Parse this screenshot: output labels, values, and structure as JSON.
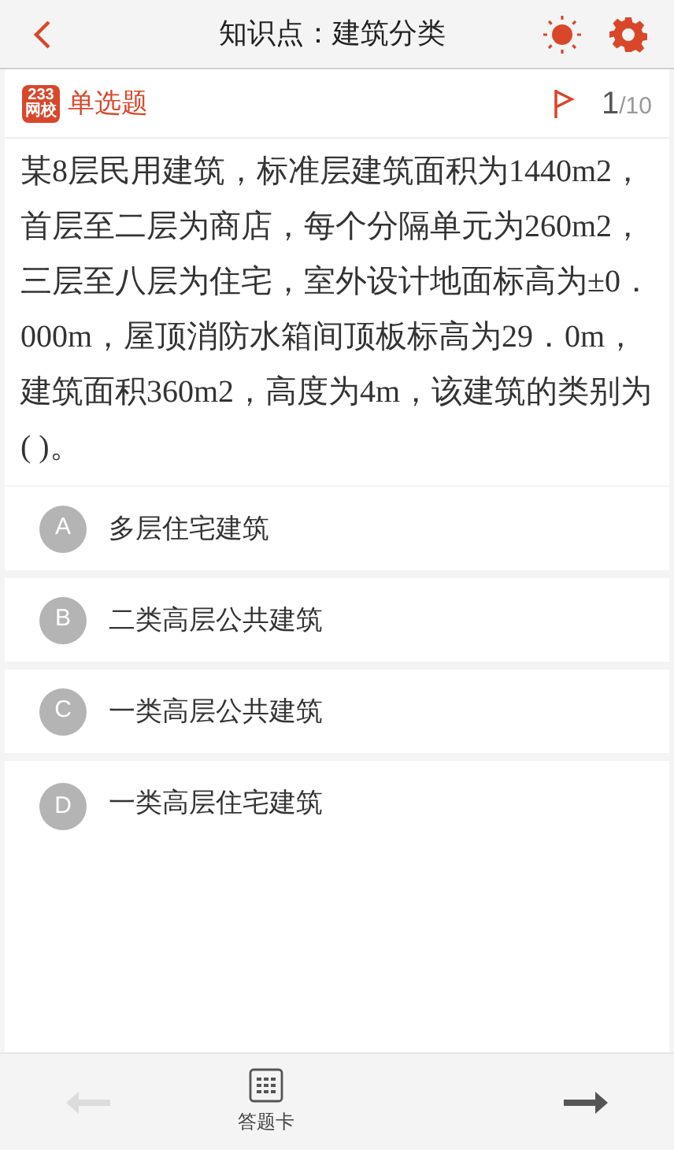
{
  "header": {
    "title": "知识点：建筑分类"
  },
  "question_bar": {
    "logo_lines": [
      "233",
      "网校"
    ],
    "type": "单选题",
    "current": "1",
    "total": "/10"
  },
  "question": "某8层民用建筑，标准层建筑面积为1440m2，首层至二层为商店，每个分隔单元为260m2，三层至八层为住宅，室外设计地面标高为±0．000m，屋顶消防水箱间顶板标高为29．0m，建筑面积360m2，高度为4m，该建筑的类别为(  )。",
  "options": [
    {
      "letter": "A",
      "text": "多层住宅建筑",
      "selected": false
    },
    {
      "letter": "B",
      "text": "二类高层公共建筑",
      "selected": false
    },
    {
      "letter": "C",
      "text": "一类高层公共建筑",
      "selected": false
    },
    {
      "letter": "D",
      "text": "一类高层住宅建筑",
      "selected": false
    }
  ],
  "footer": {
    "prev_disabled": true,
    "next_disabled": false,
    "card_label": "答题卡"
  }
}
